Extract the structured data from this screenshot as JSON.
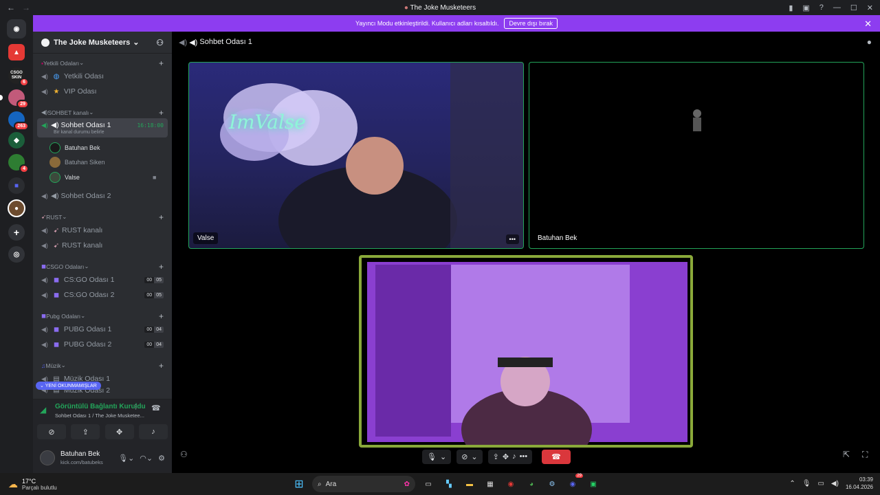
{
  "window": {
    "title": "The Joke Musketeers"
  },
  "banner": {
    "text": "Yayıncı Modu etkinleştirildi. Kullanıcı adları kısaltıldı.",
    "button": "Devre dışı bırak"
  },
  "rail": {
    "badges": [
      "6",
      "29",
      "263",
      "4"
    ],
    "server_labels": [
      "CSGO SKIN"
    ]
  },
  "guild": {
    "name": "The Joke Musketeers"
  },
  "sidebar": {
    "categories": [
      {
        "label": "Yetkili Odaları"
      },
      {
        "label": "SOHBET kanalı"
      },
      {
        "label": "RUST"
      },
      {
        "label": "CSGO Odaları"
      },
      {
        "label": "Pubg Odaları"
      },
      {
        "label": "Müzik"
      }
    ],
    "channels": [
      {
        "label": "Yetkili Odası"
      },
      {
        "label": "VIP Odası"
      },
      {
        "label": "Sohbet Odası 1",
        "timer": "16:18:00",
        "status": "Bir kanal durumu belirle"
      },
      {
        "label": "Sohbet Odası 2"
      },
      {
        "label": "RUST kanalı"
      },
      {
        "label": "RUST kanalı"
      },
      {
        "label": "CS:GO Odası 1",
        "count": "00",
        "limit": "05"
      },
      {
        "label": "CS:GO Odası 2",
        "count": "00",
        "limit": "05"
      },
      {
        "label": "PUBG Odası 1",
        "count": "00",
        "limit": "04"
      },
      {
        "label": "PUBG Odası 2",
        "count": "00",
        "limit": "04"
      },
      {
        "label": "Müzik Odası 1"
      },
      {
        "label": "Müzik Odası 2"
      }
    ],
    "voice_users": [
      {
        "name": "Batuhan Bek"
      },
      {
        "name": "Batuhan Siken"
      },
      {
        "name": "Valse"
      }
    ],
    "unread_label": "YENİ OKUNMAMIŞLAR"
  },
  "voice_panel": {
    "status": "Görüntülü Bağlantı Kuruldu",
    "channel": "Sohbet Odası 1 / The Joke Musketee..."
  },
  "user_panel": {
    "name": "Batuhan Bek",
    "status": "kick.com/batubeks"
  },
  "main": {
    "channel_title": "Sohbet Odası 1",
    "tiles": [
      {
        "label": "Valse",
        "overlay_text": "ImValse"
      },
      {
        "label": "Batuhan Bek"
      }
    ]
  },
  "taskbar": {
    "weather_temp": "17°C",
    "weather_desc": "Parçalı bulutlu",
    "search_placeholder": "Ara",
    "time": "03:39",
    "date": "16.04.2026",
    "discord_badge": "29"
  },
  "colors": {
    "accent": "#8d3df0",
    "speaking": "#23a55a",
    "leave": "#da373c",
    "blurple": "#5865f2"
  }
}
